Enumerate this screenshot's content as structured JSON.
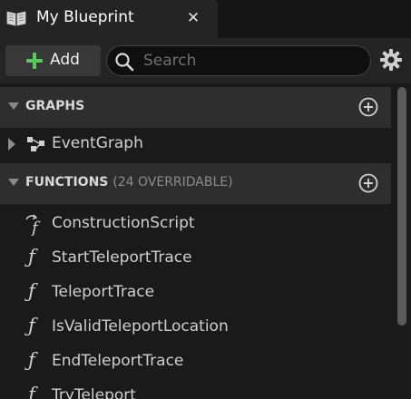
{
  "tab": {
    "title": "My Blueprint",
    "close_glyph": "✕",
    "icon": "book-icon"
  },
  "toolbar": {
    "add_label": "Add",
    "search_placeholder": "Search",
    "search_value": "",
    "settings_icon": "gear-icon"
  },
  "sections": {
    "graphs": {
      "title": "GRAPHS",
      "subtitle": ""
    },
    "functions": {
      "title": "FUNCTIONS",
      "subtitle": "(24 OVERRIDABLE)"
    }
  },
  "graphs": [
    {
      "label": "EventGraph",
      "icon": "graph-icon"
    }
  ],
  "functions": [
    {
      "label": "ConstructionScript",
      "icon": "construction-script-icon"
    },
    {
      "label": "StartTeleportTrace",
      "icon": "function-icon"
    },
    {
      "label": "TeleportTrace",
      "icon": "function-icon"
    },
    {
      "label": "IsValidTeleportLocation",
      "icon": "function-icon"
    },
    {
      "label": "EndTeleportTrace",
      "icon": "function-icon"
    },
    {
      "label": "TryTeleport",
      "icon": "function-icon"
    }
  ],
  "colors": {
    "add_plus": "#5bc85b",
    "section_bg": "#2e2e2e",
    "panel_bg": "#1a1a1a"
  }
}
